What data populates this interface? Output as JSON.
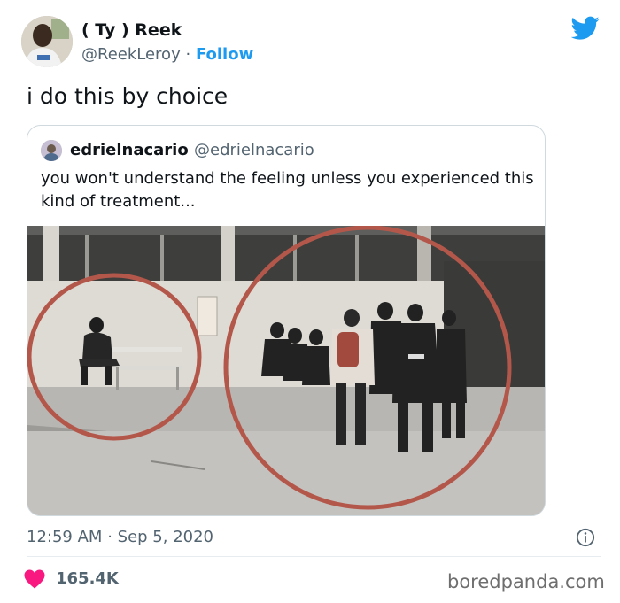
{
  "author": {
    "display_name": "( Ty ) Reek",
    "handle": "@ReekLeroy",
    "separator": "·",
    "follow_label": "Follow"
  },
  "tweet": {
    "text": "i do this by choice",
    "time": "12:59 AM",
    "date_separator": "·",
    "date": "Sep 5, 2020",
    "likes": "165.4K"
  },
  "quote": {
    "name": "edrielnacario",
    "handle": "@edrielnacario",
    "text": "you won't understand the feeling unless you experienced this kind of treatment..."
  },
  "watermark": "boredpanda.com",
  "colors": {
    "accent": "#1d9bf0",
    "like": "#f91880",
    "muted": "#536471",
    "circle": "#b4574b"
  },
  "icons": {
    "brand": "twitter-bird-icon",
    "info": "info-icon",
    "like": "heart-icon"
  }
}
